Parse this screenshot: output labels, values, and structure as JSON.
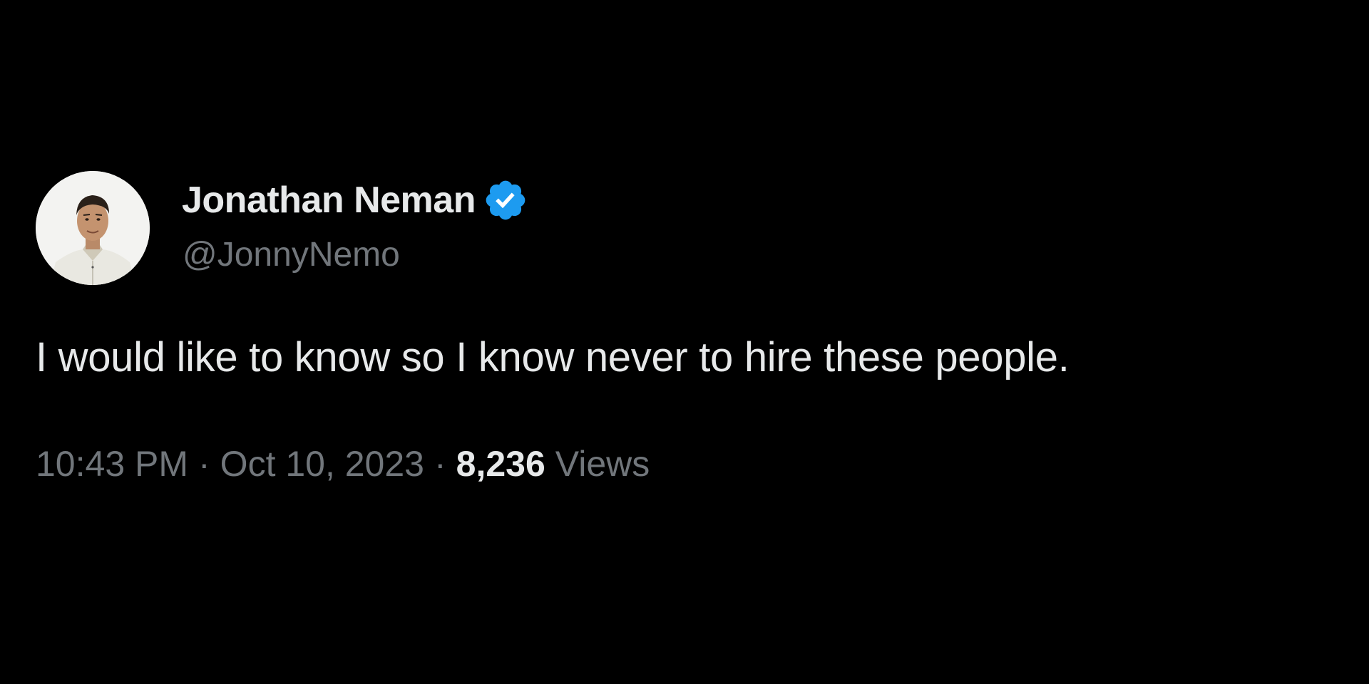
{
  "author": {
    "display_name": "Jonathan Neman",
    "handle": "@JonnyNemo",
    "verified": true,
    "verified_icon": "verified-badge-icon",
    "avatar_icon": "profile-photo"
  },
  "tweet": {
    "text": "I would like to know so I know never to hire these people."
  },
  "meta": {
    "time": "10:43 PM",
    "separator": "·",
    "date": "Oct 10, 2023",
    "views_count": "8,236",
    "views_label": "Views"
  },
  "colors": {
    "background": "#000000",
    "primary_text": "#e7e9ea",
    "secondary_text": "#71767b",
    "verified_blue": "#1d9bf0"
  }
}
